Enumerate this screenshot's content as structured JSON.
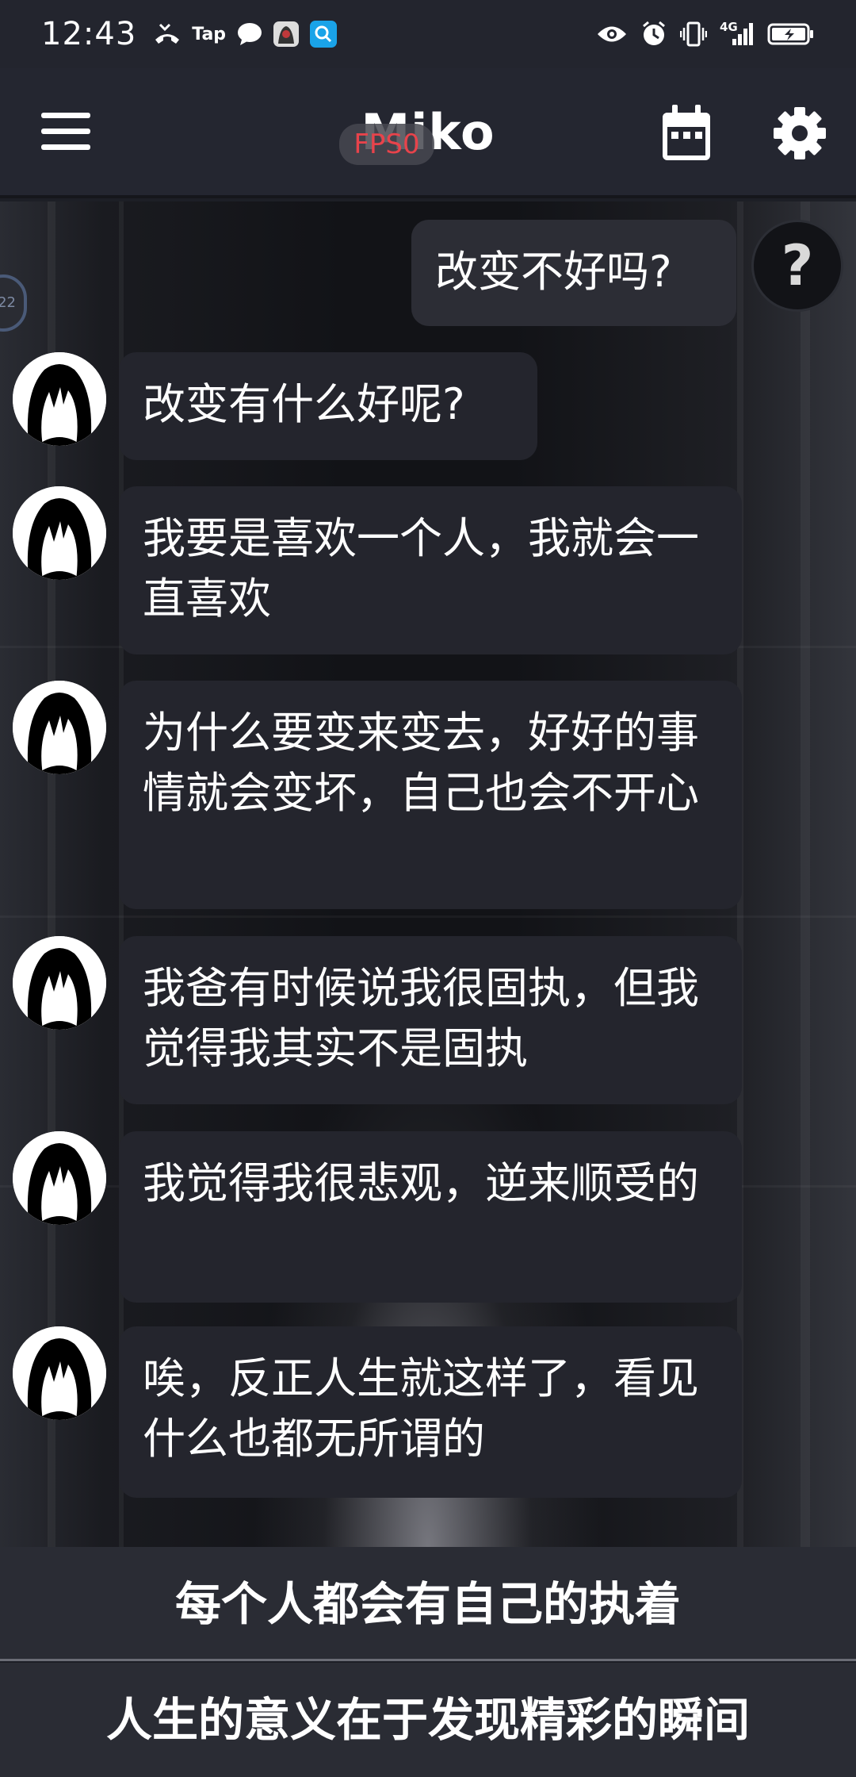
{
  "status_bar": {
    "time": "12:43",
    "left_icons": [
      "missed-call-icon",
      "tap-app-icon",
      "chat-bubble-icon",
      "app-avatar-icon",
      "search-app-icon"
    ],
    "tap_label": "Tap",
    "network_label": "4G",
    "right_icons": [
      "eye-icon",
      "alarm-icon",
      "vibrate-icon",
      "signal-icon",
      "battery-icon"
    ]
  },
  "app_bar": {
    "title": "Miko",
    "fps_label": "FPS0"
  },
  "help_label": "?",
  "side_pill_label": "22",
  "messages": [
    {
      "role": "user",
      "text": "改变不好吗?"
    },
    {
      "role": "bot",
      "text": "改变有什么好呢?"
    },
    {
      "role": "bot",
      "text": "我要是喜欢一个人，我就会一直喜欢"
    },
    {
      "role": "bot",
      "text": "为什么要变来变去，好好的事情就会变坏，自己也会不开心"
    },
    {
      "role": "bot",
      "text": "我爸有时候说我很固执，但我觉得我其实不是固执"
    },
    {
      "role": "bot",
      "text": "我觉得我很悲观，逆来顺受的"
    },
    {
      "role": "bot",
      "text": "唉，反正人生就这样了，看见什么也都无所谓的"
    }
  ],
  "suggestions": [
    "每个人都会有自己的执着",
    "人生的意义在于发现精彩的瞬间"
  ]
}
